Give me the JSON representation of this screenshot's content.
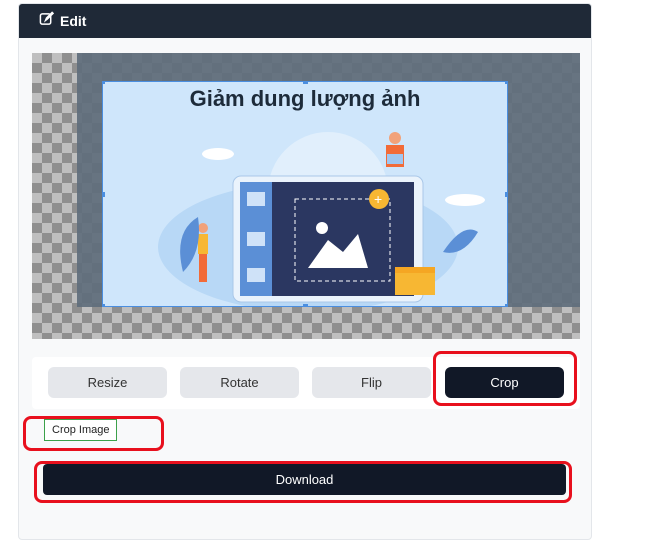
{
  "header": {
    "title": "Edit",
    "icon": "edit-icon"
  },
  "image": {
    "headline": "Giảm dung lượng ảnh"
  },
  "toolbar": {
    "resize_label": "Resize",
    "rotate_label": "Rotate",
    "flip_label": "Flip",
    "crop_label": "Crop",
    "active": "Crop"
  },
  "crop_image_label": "Crop Image",
  "download_label": "Download",
  "colors": {
    "header_bg": "#1f2937",
    "active_bg": "#111827",
    "highlight": "#e8101d",
    "selection": "#4a8ee0"
  }
}
